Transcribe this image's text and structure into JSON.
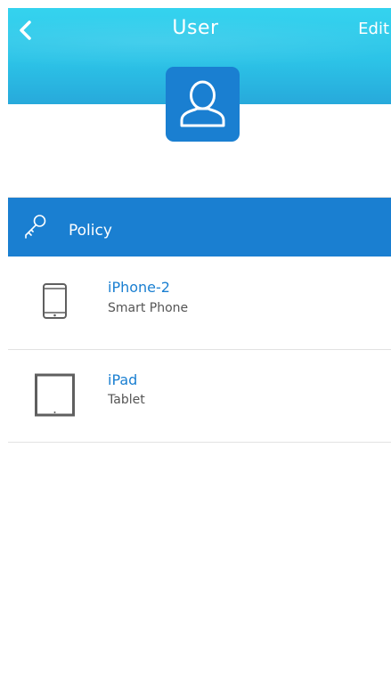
{
  "header": {
    "title": "User",
    "edit_label": "Edit",
    "back_icon": "chevron-left-icon",
    "avatar_icon": "user-icon"
  },
  "policy": {
    "label": "Policy",
    "icon": "key-icon"
  },
  "devices": [
    {
      "name": "iPhone-2",
      "type": "Smart Phone",
      "icon": "smartphone-icon"
    },
    {
      "name": "iPad",
      "type": "Tablet",
      "icon": "tablet-icon"
    }
  ],
  "colors": {
    "header_gradient_top": "#35d3ef",
    "header_gradient_bottom": "#27a9db",
    "accent_blue": "#1a7fd1",
    "device_name": "#1a7fd1",
    "device_type": "#555555",
    "device_icon": "#5f5f5f"
  }
}
